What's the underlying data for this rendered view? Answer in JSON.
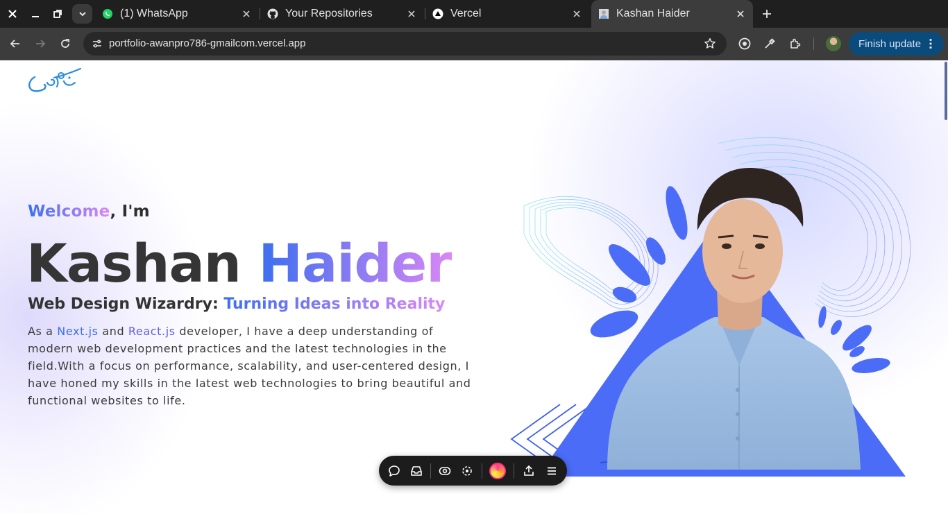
{
  "browser": {
    "tabs": [
      {
        "title": "(1) WhatsApp",
        "active": false,
        "icon": "whatsapp-icon"
      },
      {
        "title": "Your Repositories",
        "active": false,
        "icon": "github-icon"
      },
      {
        "title": "Vercel",
        "active": false,
        "icon": "vercel-icon"
      },
      {
        "title": "Kashan Haider",
        "active": true,
        "icon": "avatar-icon"
      }
    ],
    "url": "portfolio-awanpro786-gmailcom.vercel.app",
    "finish_update_label": "Finish update"
  },
  "page": {
    "welcome": {
      "highlight": "Welcome",
      "rest": ", I'm"
    },
    "name": {
      "first": "Kashan",
      "last": "Haider"
    },
    "tagline": {
      "plain": "Web Design Wizardry:",
      "highlight": "Turning Ideas into Reality"
    },
    "bio": {
      "part1": "As a ",
      "link1": "Next.js",
      "part2": " and ",
      "link2": "React.js",
      "part3": " developer, I have a deep understanding of modern web development practices and the latest technologies in the field.With a focus on performance, scalability, and user-centered design, I have honed my skills in the latest web technologies to bring beautiful and functional websites to life."
    }
  },
  "colors": {
    "accent_blue": "#3b6ff0",
    "accent_pink": "#d987f5",
    "shape_blue": "#4a6cf7",
    "chrome_dark": "#1f1f1f"
  }
}
